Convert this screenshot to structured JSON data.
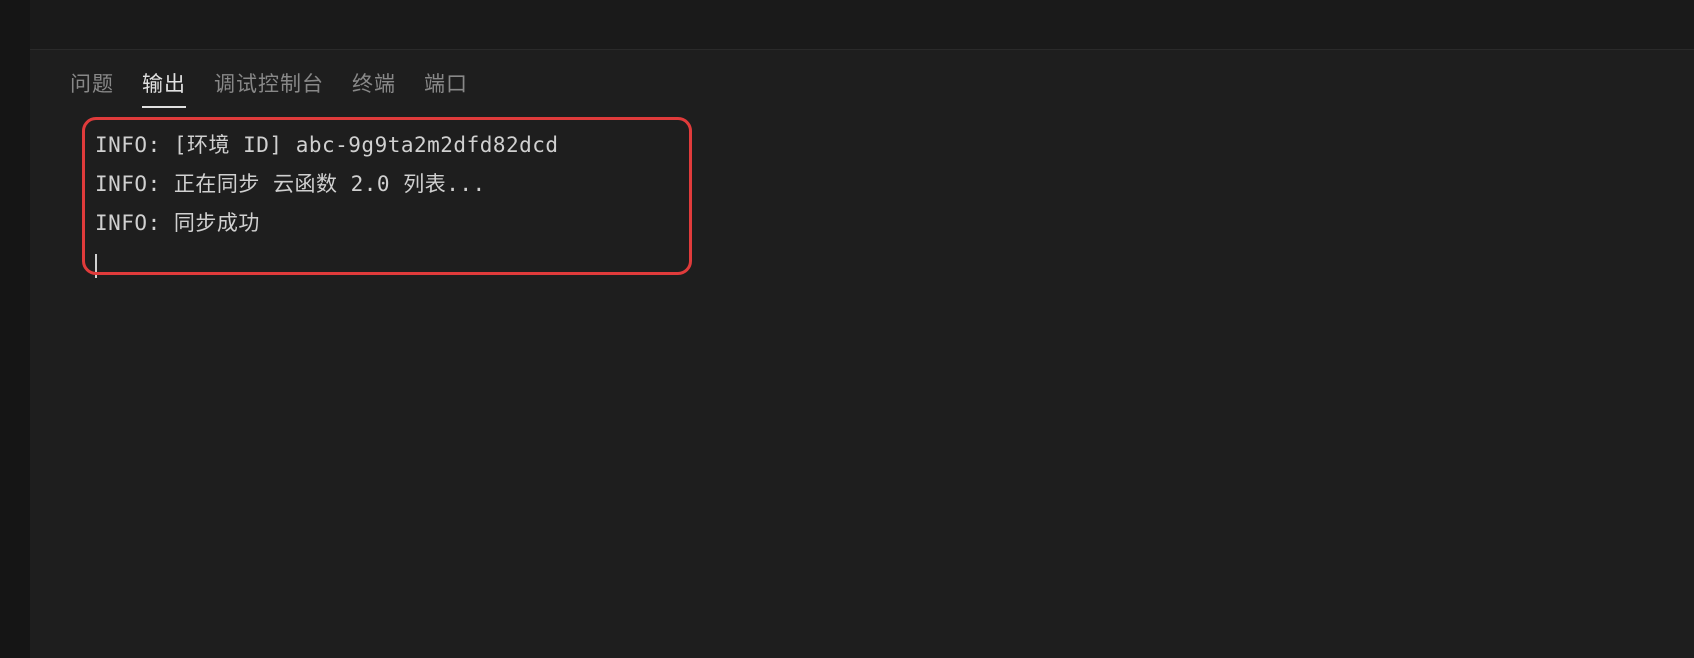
{
  "tabs": {
    "problems": "问题",
    "output": "输出",
    "debug_console": "调试控制台",
    "terminal": "终端",
    "ports": "端口"
  },
  "active_tab": "output",
  "log_lines": [
    "INFO: [环境 ID] abc-9g9ta2m2dfd82dcd",
    "INFO: 正在同步 云函数 2.0 列表...",
    "INFO: 同步成功"
  ]
}
